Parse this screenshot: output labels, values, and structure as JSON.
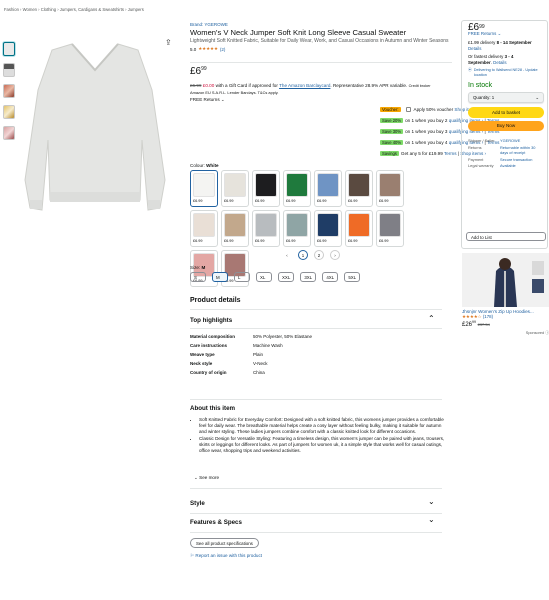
{
  "breadcrumb": "Fashion › Women › Clothing › Jumpers, Cardigans & Sweatshirts › Jumpers",
  "brand_link": "Brand: YGEROWE",
  "product": {
    "title": "Women's V Neck Jumper Soft Knit Long Sleeve Casual Sweater",
    "subtitle": "Lightweight Soft Knitted Fabric, Suitable for Daily Wear, Work, and Casual Occasions in Autumn and Winter Seasons",
    "rating_value": "5.0",
    "stars": "★★★★★",
    "rating_count": "(2)",
    "price_pounds": "£6",
    "price_pence": "99",
    "gift_old": "£6.99",
    "gift_new": "£0.00",
    "gift_text": "with a Gift Card if approved for",
    "gift_link": "The Amazon Barclaycard",
    "gift_tail": ". Representative 28.9% APR variable.",
    "gift_credit": "Credit broker",
    "gift_line2": "Amazon EU S.A.R.L. Lender Barclays. T&Cs apply.",
    "free_returns": "FREE Returns ⌄"
  },
  "promos": [
    {
      "badge": "Voucher:",
      "text": "Apply 50% voucher",
      "link1": "Shop items ›",
      "sep": "|",
      "link2": "Terms",
      "kind": "voucher"
    },
    {
      "badge": "Save 20%",
      "text": "on 1 when you buy 2",
      "link1": "qualifying items ›",
      "sep": "|",
      "link2": "Terms",
      "kind": "save"
    },
    {
      "badge": "Save 30%",
      "text": "on 1 when you buy 3",
      "link1": "qualifying items ›",
      "sep": "|",
      "link2": "Terms",
      "kind": "save"
    },
    {
      "badge": "Save 40%",
      "text": "on 1 when you buy 4",
      "link1": "qualifying items ›",
      "sep": "|",
      "link2": "Terms",
      "kind": "save"
    },
    {
      "badge": "Savings",
      "text": "Get any 5 for £19.99",
      "link1": "Terms",
      "sep": "|",
      "link2": "Shop items ›",
      "kind": "save"
    }
  ],
  "colour_label": "Colour:",
  "colour_value": "White",
  "swatches": [
    {
      "price": "£6.99",
      "color": "#f4f4f2"
    },
    {
      "price": "£6.99",
      "color": "#e6e3dc"
    },
    {
      "price": "£6.99",
      "color": "#1d1d1f"
    },
    {
      "price": "£6.99",
      "color": "#1f7a3d"
    },
    {
      "price": "£6.99",
      "color": "#6f94c4"
    },
    {
      "price": "£6.99",
      "color": "#5a4a40"
    },
    {
      "price": "£6.99",
      "color": "#9a7f70"
    },
    {
      "price": "£6.99",
      "color": "#e9dfd6"
    },
    {
      "price": "£6.99",
      "color": "#c2a88c"
    },
    {
      "price": "£6.99",
      "color": "#b8bcbf"
    },
    {
      "price": "£6.99",
      "color": "#8fa5a5"
    },
    {
      "price": "£6.99",
      "color": "#1f3d66"
    },
    {
      "price": "£6.99",
      "color": "#ef6b26"
    },
    {
      "price": "£6.99",
      "color": "#7f7f86"
    },
    {
      "price": "£6.99",
      "color": "#e3a7a4"
    },
    {
      "price": "£6.99",
      "color": "#a87873"
    }
  ],
  "pager": {
    "prev": "‹",
    "pages": [
      "1",
      "2"
    ],
    "next": "›"
  },
  "size_label": "Size:",
  "size_value": "M",
  "sizes": [
    "S",
    "M",
    "L",
    "XL",
    "XXL",
    "3XL",
    "4XL",
    "5XL"
  ],
  "details": {
    "heading": "Product details",
    "top_highlights": "Top highlights",
    "rows": [
      {
        "k": "Material composition",
        "v": "50% Polyester, 50% Elastane"
      },
      {
        "k": "Care instructions",
        "v": "Machine Wash"
      },
      {
        "k": "Weave type",
        "v": "Plain"
      },
      {
        "k": "Neck style",
        "v": "V-Neck"
      },
      {
        "k": "Country of origin",
        "v": "China"
      }
    ]
  },
  "about": {
    "heading": "About this item",
    "bullets": [
      "Soft Knitted Fabric for Everyday Comfort: Designed with a soft knitted fabric, this womens jumper provides a comfortable feel for daily wear. The breathable material helps create a cosy layer without feeling bulky, making it suitable for autumn and winter styling. These ladies jumpers combine comfort with a classic knitted look for different occasions.",
      "Classic Design for Versatile Styling: Featuring a timeless design, this women's jumper can be paired with jeans, trousers, skirts or leggings for different looks. As part of jumpers for women uk, it a simple style that works well for casual outings, office wear, shopping trips and weekend activities."
    ],
    "see_more": "⌄ See more"
  },
  "sections": {
    "style": "Style",
    "features": "Features & Specs",
    "see_all": "See all product specifications",
    "report": "Report an issue with this product"
  },
  "buybox": {
    "price_pounds": "£6",
    "price_pence": "99",
    "free_returns": "FREE Returns ⌄",
    "delivery": "£1.99 delivery",
    "delivery_date": "8 - 14 September",
    "details": "Details",
    "fastest_prefix": "Or fastest delivery",
    "fastest_date": "3 - 4",
    "fastest_month": "September",
    "deliver_to": "Delivering to Wallsend NE28 - Update location",
    "stock": "In stock",
    "qty": "Quantity: 1",
    "add_cart": "Add to basket",
    "buy_now": "Buy Now",
    "rows": [
      {
        "k": "Shipper / Seller",
        "v": "YGEROWE"
      },
      {
        "k": "Returns",
        "v": "Returnable within 30 days of receipt"
      },
      {
        "k": "Payment",
        "v": "Secure transaction"
      },
      {
        "k": "Legal warranty",
        "v": "Available"
      }
    ],
    "add_list": "Add to List"
  },
  "ad": {
    "title": "Jhsnjnr Women's Zip Up Hoodies...",
    "stars": "★★★★☆",
    "count": "(178)",
    "price": "£26",
    "price_sup": "99",
    "old_price": "£37.54",
    "sponsored": "Sponsored ⓘ"
  }
}
